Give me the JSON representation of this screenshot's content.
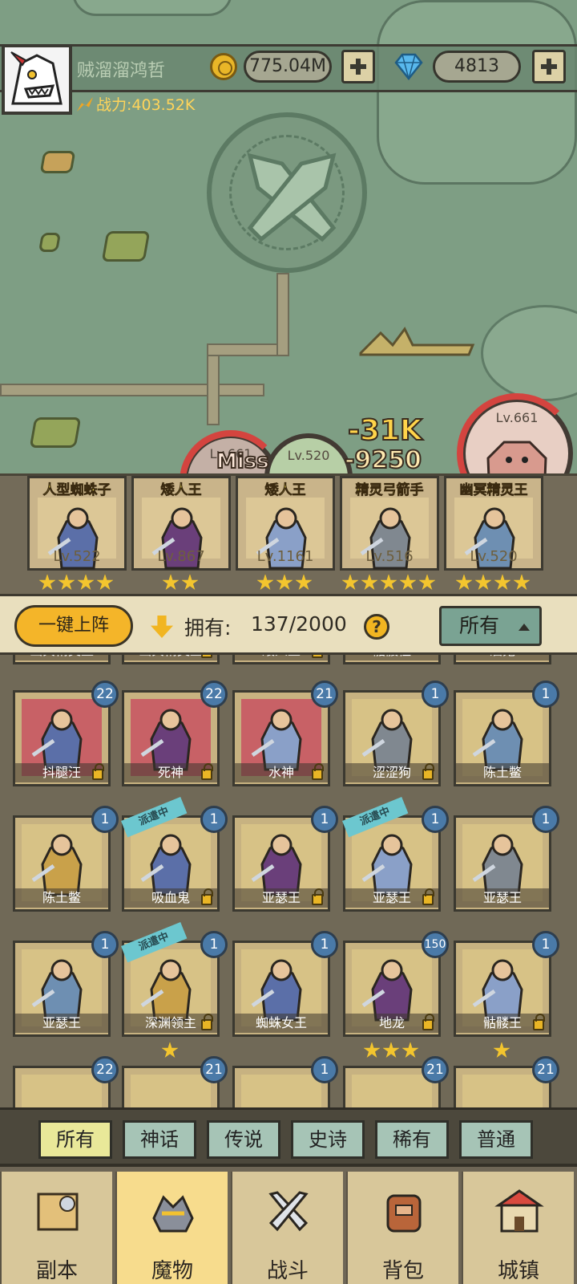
{
  "player": {
    "name": "贼溜溜鸿哲",
    "power": "战力:403.52K"
  },
  "resources": {
    "gold": "775.04M",
    "gems": "4813"
  },
  "battle": {
    "enemies": [
      {
        "level": "Lv.661"
      },
      {
        "level": "Lv.661"
      },
      {
        "level": "Lv.520"
      }
    ],
    "damage": [
      "Miss",
      "-31K",
      "-9250"
    ]
  },
  "team": [
    {
      "name": "人型蜘蛛子",
      "level": "Lv.522",
      "stars": 4
    },
    {
      "name": "矮人王",
      "level": "Lv.867",
      "stars": 2
    },
    {
      "name": "矮人王",
      "level": "Lv.1161",
      "stars": 3
    },
    {
      "name": "精灵弓箭手",
      "level": "Lv.516",
      "stars": 5
    },
    {
      "name": "幽冥精灵王",
      "level": "Lv.520",
      "stars": 4
    }
  ],
  "collection": {
    "deploy_label": "一键上阵",
    "own_label": "拥有:",
    "own_count": "137/2000",
    "help": "?",
    "filter_dropdown": "所有",
    "dispatch_ribbon": "派遣中",
    "partial_row": [
      "幽冥精灵王",
      "幽冥精灵王",
      "矮人王",
      "骷髅怪",
      "酒鬼"
    ],
    "rows": [
      [
        {
          "name": "抖腿汪",
          "count": "22",
          "red": true,
          "lock": true,
          "dispatch": false,
          "stars": 0
        },
        {
          "name": "死神",
          "count": "22",
          "red": true,
          "lock": true,
          "dispatch": false,
          "stars": 0
        },
        {
          "name": "水神",
          "count": "21",
          "red": true,
          "lock": true,
          "dispatch": false,
          "stars": 0
        },
        {
          "name": "涩涩狗",
          "count": "1",
          "red": false,
          "lock": true,
          "dispatch": false,
          "stars": 0
        },
        {
          "name": "陈土鳖",
          "count": "1",
          "red": false,
          "lock": false,
          "dispatch": false,
          "stars": 0
        }
      ],
      [
        {
          "name": "陈土鳖",
          "count": "1",
          "red": false,
          "lock": false,
          "dispatch": false,
          "stars": 0
        },
        {
          "name": "吸血鬼",
          "count": "1",
          "red": false,
          "lock": true,
          "dispatch": true,
          "stars": 0
        },
        {
          "name": "亚瑟王",
          "count": "1",
          "red": false,
          "lock": true,
          "dispatch": false,
          "stars": 0
        },
        {
          "name": "亚瑟王",
          "count": "1",
          "red": false,
          "lock": true,
          "dispatch": true,
          "stars": 0
        },
        {
          "name": "亚瑟王",
          "count": "1",
          "red": false,
          "lock": false,
          "dispatch": false,
          "stars": 0
        }
      ],
      [
        {
          "name": "亚瑟王",
          "count": "1",
          "red": false,
          "lock": false,
          "dispatch": false,
          "stars": 0
        },
        {
          "name": "深渊领主",
          "count": "1",
          "red": false,
          "lock": true,
          "dispatch": true,
          "stars": 1
        },
        {
          "name": "蜘蛛女王",
          "count": "1",
          "red": false,
          "lock": false,
          "dispatch": false,
          "stars": 0
        },
        {
          "name": "地龙",
          "count": "150",
          "red": false,
          "lock": true,
          "dispatch": false,
          "stars": 3
        },
        {
          "name": "骷髅王",
          "count": "1",
          "red": false,
          "lock": true,
          "dispatch": false,
          "stars": 1
        }
      ]
    ],
    "next_row_counts": [
      "22",
      "21",
      "1",
      "21",
      "21"
    ]
  },
  "filters": [
    "所有",
    "神话",
    "传说",
    "史诗",
    "稀有",
    "普通"
  ],
  "nav": [
    "副本",
    "魔物",
    "战斗",
    "背包",
    "城镇"
  ],
  "colors": {
    "gold_accent": "#f4b529",
    "badge_blue": "#4a7aa8",
    "active_tab": "#e9e899",
    "nav_active": "#f7dc8d"
  }
}
